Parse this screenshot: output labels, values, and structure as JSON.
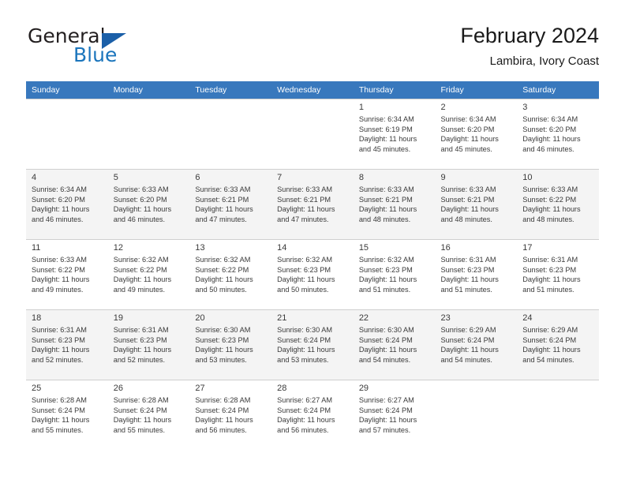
{
  "brand": {
    "word1": "General",
    "word2": "Blue",
    "triangle_icon": "triangle-icon",
    "color_dark": "#231f20",
    "color_blue": "#1b75bc"
  },
  "header": {
    "title": "February 2024",
    "subtitle": "Lambira, Ivory Coast"
  },
  "theme": {
    "header_row_bg": "#3878bd",
    "header_row_text": "#ffffff",
    "shaded_row_bg": "#f4f4f4",
    "cell_border": "#cfcfcf",
    "text": "#3a3a3a"
  },
  "weekday_headers": [
    "Sunday",
    "Monday",
    "Tuesday",
    "Wednesday",
    "Thursday",
    "Friday",
    "Saturday"
  ],
  "weeks": [
    {
      "shaded": false,
      "days": [
        {
          "empty": true
        },
        {
          "empty": true
        },
        {
          "empty": true
        },
        {
          "empty": true
        },
        {
          "empty": false,
          "num": "1",
          "sunrise": "Sunrise: 6:34 AM",
          "sunset": "Sunset: 6:19 PM",
          "daylight1": "Daylight: 11 hours",
          "daylight2": "and 45 minutes."
        },
        {
          "empty": false,
          "num": "2",
          "sunrise": "Sunrise: 6:34 AM",
          "sunset": "Sunset: 6:20 PM",
          "daylight1": "Daylight: 11 hours",
          "daylight2": "and 45 minutes."
        },
        {
          "empty": false,
          "num": "3",
          "sunrise": "Sunrise: 6:34 AM",
          "sunset": "Sunset: 6:20 PM",
          "daylight1": "Daylight: 11 hours",
          "daylight2": "and 46 minutes."
        }
      ]
    },
    {
      "shaded": true,
      "days": [
        {
          "empty": false,
          "num": "4",
          "sunrise": "Sunrise: 6:34 AM",
          "sunset": "Sunset: 6:20 PM",
          "daylight1": "Daylight: 11 hours",
          "daylight2": "and 46 minutes."
        },
        {
          "empty": false,
          "num": "5",
          "sunrise": "Sunrise: 6:33 AM",
          "sunset": "Sunset: 6:20 PM",
          "daylight1": "Daylight: 11 hours",
          "daylight2": "and 46 minutes."
        },
        {
          "empty": false,
          "num": "6",
          "sunrise": "Sunrise: 6:33 AM",
          "sunset": "Sunset: 6:21 PM",
          "daylight1": "Daylight: 11 hours",
          "daylight2": "and 47 minutes."
        },
        {
          "empty": false,
          "num": "7",
          "sunrise": "Sunrise: 6:33 AM",
          "sunset": "Sunset: 6:21 PM",
          "daylight1": "Daylight: 11 hours",
          "daylight2": "and 47 minutes."
        },
        {
          "empty": false,
          "num": "8",
          "sunrise": "Sunrise: 6:33 AM",
          "sunset": "Sunset: 6:21 PM",
          "daylight1": "Daylight: 11 hours",
          "daylight2": "and 48 minutes."
        },
        {
          "empty": false,
          "num": "9",
          "sunrise": "Sunrise: 6:33 AM",
          "sunset": "Sunset: 6:21 PM",
          "daylight1": "Daylight: 11 hours",
          "daylight2": "and 48 minutes."
        },
        {
          "empty": false,
          "num": "10",
          "sunrise": "Sunrise: 6:33 AM",
          "sunset": "Sunset: 6:22 PM",
          "daylight1": "Daylight: 11 hours",
          "daylight2": "and 48 minutes."
        }
      ]
    },
    {
      "shaded": false,
      "days": [
        {
          "empty": false,
          "num": "11",
          "sunrise": "Sunrise: 6:33 AM",
          "sunset": "Sunset: 6:22 PM",
          "daylight1": "Daylight: 11 hours",
          "daylight2": "and 49 minutes."
        },
        {
          "empty": false,
          "num": "12",
          "sunrise": "Sunrise: 6:32 AM",
          "sunset": "Sunset: 6:22 PM",
          "daylight1": "Daylight: 11 hours",
          "daylight2": "and 49 minutes."
        },
        {
          "empty": false,
          "num": "13",
          "sunrise": "Sunrise: 6:32 AM",
          "sunset": "Sunset: 6:22 PM",
          "daylight1": "Daylight: 11 hours",
          "daylight2": "and 50 minutes."
        },
        {
          "empty": false,
          "num": "14",
          "sunrise": "Sunrise: 6:32 AM",
          "sunset": "Sunset: 6:23 PM",
          "daylight1": "Daylight: 11 hours",
          "daylight2": "and 50 minutes."
        },
        {
          "empty": false,
          "num": "15",
          "sunrise": "Sunrise: 6:32 AM",
          "sunset": "Sunset: 6:23 PM",
          "daylight1": "Daylight: 11 hours",
          "daylight2": "and 51 minutes."
        },
        {
          "empty": false,
          "num": "16",
          "sunrise": "Sunrise: 6:31 AM",
          "sunset": "Sunset: 6:23 PM",
          "daylight1": "Daylight: 11 hours",
          "daylight2": "and 51 minutes."
        },
        {
          "empty": false,
          "num": "17",
          "sunrise": "Sunrise: 6:31 AM",
          "sunset": "Sunset: 6:23 PM",
          "daylight1": "Daylight: 11 hours",
          "daylight2": "and 51 minutes."
        }
      ]
    },
    {
      "shaded": true,
      "days": [
        {
          "empty": false,
          "num": "18",
          "sunrise": "Sunrise: 6:31 AM",
          "sunset": "Sunset: 6:23 PM",
          "daylight1": "Daylight: 11 hours",
          "daylight2": "and 52 minutes."
        },
        {
          "empty": false,
          "num": "19",
          "sunrise": "Sunrise: 6:31 AM",
          "sunset": "Sunset: 6:23 PM",
          "daylight1": "Daylight: 11 hours",
          "daylight2": "and 52 minutes."
        },
        {
          "empty": false,
          "num": "20",
          "sunrise": "Sunrise: 6:30 AM",
          "sunset": "Sunset: 6:23 PM",
          "daylight1": "Daylight: 11 hours",
          "daylight2": "and 53 minutes."
        },
        {
          "empty": false,
          "num": "21",
          "sunrise": "Sunrise: 6:30 AM",
          "sunset": "Sunset: 6:24 PM",
          "daylight1": "Daylight: 11 hours",
          "daylight2": "and 53 minutes."
        },
        {
          "empty": false,
          "num": "22",
          "sunrise": "Sunrise: 6:30 AM",
          "sunset": "Sunset: 6:24 PM",
          "daylight1": "Daylight: 11 hours",
          "daylight2": "and 54 minutes."
        },
        {
          "empty": false,
          "num": "23",
          "sunrise": "Sunrise: 6:29 AM",
          "sunset": "Sunset: 6:24 PM",
          "daylight1": "Daylight: 11 hours",
          "daylight2": "and 54 minutes."
        },
        {
          "empty": false,
          "num": "24",
          "sunrise": "Sunrise: 6:29 AM",
          "sunset": "Sunset: 6:24 PM",
          "daylight1": "Daylight: 11 hours",
          "daylight2": "and 54 minutes."
        }
      ]
    },
    {
      "shaded": false,
      "days": [
        {
          "empty": false,
          "num": "25",
          "sunrise": "Sunrise: 6:28 AM",
          "sunset": "Sunset: 6:24 PM",
          "daylight1": "Daylight: 11 hours",
          "daylight2": "and 55 minutes."
        },
        {
          "empty": false,
          "num": "26",
          "sunrise": "Sunrise: 6:28 AM",
          "sunset": "Sunset: 6:24 PM",
          "daylight1": "Daylight: 11 hours",
          "daylight2": "and 55 minutes."
        },
        {
          "empty": false,
          "num": "27",
          "sunrise": "Sunrise: 6:28 AM",
          "sunset": "Sunset: 6:24 PM",
          "daylight1": "Daylight: 11 hours",
          "daylight2": "and 56 minutes."
        },
        {
          "empty": false,
          "num": "28",
          "sunrise": "Sunrise: 6:27 AM",
          "sunset": "Sunset: 6:24 PM",
          "daylight1": "Daylight: 11 hours",
          "daylight2": "and 56 minutes."
        },
        {
          "empty": false,
          "num": "29",
          "sunrise": "Sunrise: 6:27 AM",
          "sunset": "Sunset: 6:24 PM",
          "daylight1": "Daylight: 11 hours",
          "daylight2": "and 57 minutes."
        },
        {
          "empty": true
        },
        {
          "empty": true
        }
      ]
    }
  ]
}
